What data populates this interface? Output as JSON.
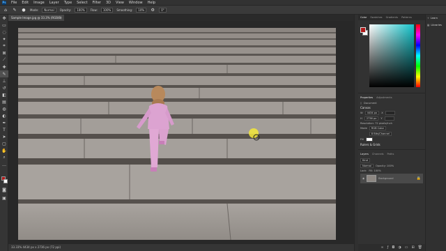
{
  "menu": [
    "File",
    "Edit",
    "Image",
    "Layer",
    "Type",
    "Select",
    "Filter",
    "3D",
    "View",
    "Window",
    "Help"
  ],
  "app_logo": "Ps",
  "options": {
    "mode_label": "Mode:",
    "mode_value": "Normal",
    "opacity_label": "Opacity:",
    "opacity_value": "100%",
    "flow_label": "Flow:",
    "flow_value": "100%",
    "smoothing_label": "Smoothing:",
    "smoothing_value": "10%",
    "angle_value": "0°"
  },
  "document": {
    "tab_title": "Sample Image.jpg @ 33.3% (RGB/8)",
    "close": "×"
  },
  "status": {
    "text": "33.33%    4434 px x 2736 px (72 ppi)"
  },
  "colors": {
    "foreground": "#b01818",
    "background": "#ffffff",
    "accent": "#1473e6"
  },
  "color_panel": {
    "tabs": [
      "Color",
      "Swatches",
      "Gradients",
      "Patterns"
    ]
  },
  "properties": {
    "tabs": [
      "Properties",
      "Adjustments"
    ],
    "doc_label": "Document",
    "canvas_label": "Canvas",
    "w_label": "W",
    "w_value": "4434 px",
    "h_label": "H",
    "h_value": "2736 px",
    "x_label": "X",
    "y_label": "Y",
    "resolution": "Resolution: 72 pixels/inch",
    "mode_label": "Mode",
    "mode_value": "RGB Color",
    "depth_value": "8 Bits/Channel",
    "fill_label": "Fill",
    "rulers_label": "Rulers & Grids"
  },
  "layers": {
    "tabs": [
      "Layers",
      "Channels",
      "Paths"
    ],
    "kind": "Kind",
    "blend": "Normal",
    "opacity": "Opacity: 100%",
    "lock": "Lock:",
    "fill": "Fill: 100%",
    "layer_name": "Background"
  },
  "side_panels": {
    "learn": "Learn",
    "libraries": "Libraries"
  }
}
